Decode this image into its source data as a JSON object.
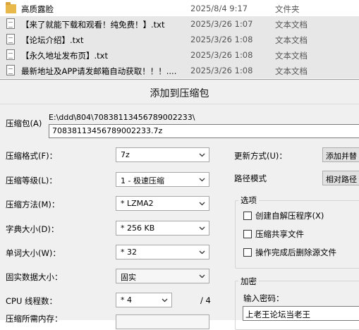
{
  "file_list": [
    {
      "name": "高质露脸",
      "date": "2025/8/4 9:17",
      "type": "文件夹",
      "icon": "folder-icon",
      "selected": false
    },
    {
      "name": "【来了就能下载和观看！纯免费！】.txt",
      "date": "2025/3/26 1:07",
      "type": "文本文档",
      "icon": "text-file-icon",
      "selected": true
    },
    {
      "name": "【论坛介绍】.txt",
      "date": "2025/3/26 1:08",
      "type": "文本文档",
      "icon": "text-file-icon",
      "selected": true
    },
    {
      "name": "【永久地址发布页】.txt",
      "date": "2025/3/26 1:08",
      "type": "文本文档",
      "icon": "text-file-icon",
      "selected": true
    },
    {
      "name": "最新地址及APP请发邮箱自动获取！！！....",
      "date": "2025/3/26 1:08",
      "type": "文本文档",
      "icon": "text-file-icon",
      "selected": true
    }
  ],
  "dialog": {
    "title": "添加到压缩包",
    "archive_label": "压缩包(A)",
    "archive_path": "E:\\ddd\\804\\70838113456789002233\\",
    "archive_name": "70838113456789002233.7z",
    "format_label": "压缩格式(F)：",
    "format_value": "7z",
    "level_label": "压缩等级(L)：",
    "level_value": "1 - 极速压缩",
    "method_label": "压缩方法(M)：",
    "method_value": "* LZMA2",
    "dict_label": "字典大小(D)：",
    "dict_value": "* 256 KB",
    "word_label": "单词大小(W)：",
    "word_value": "* 32",
    "solid_label": "固实数据大小：",
    "solid_value": "固实",
    "threads_label": "CPU 线程数：",
    "threads_value": "* 4",
    "threads_max": "/ 4",
    "memory_label": "压缩所需内存：",
    "update_label": "更新方式(U)：",
    "update_value": "添加并替",
    "pathmode_label": "路径模式",
    "pathmode_value": "相对路径",
    "options_title": "选项",
    "options": [
      {
        "label": "创建自解压程序(X)",
        "checked": false
      },
      {
        "label": "压缩共享文件",
        "checked": false
      },
      {
        "label": "操作完成后删除源文件",
        "checked": false
      }
    ],
    "encrypt_title": "加密",
    "password_label": "输入密码：",
    "password_value": "上老王论坛当老王"
  },
  "colors": {
    "dialog_bg": "#f0f0f0",
    "selected_row": "#e7e7e7",
    "folder": "#e8b84a"
  }
}
